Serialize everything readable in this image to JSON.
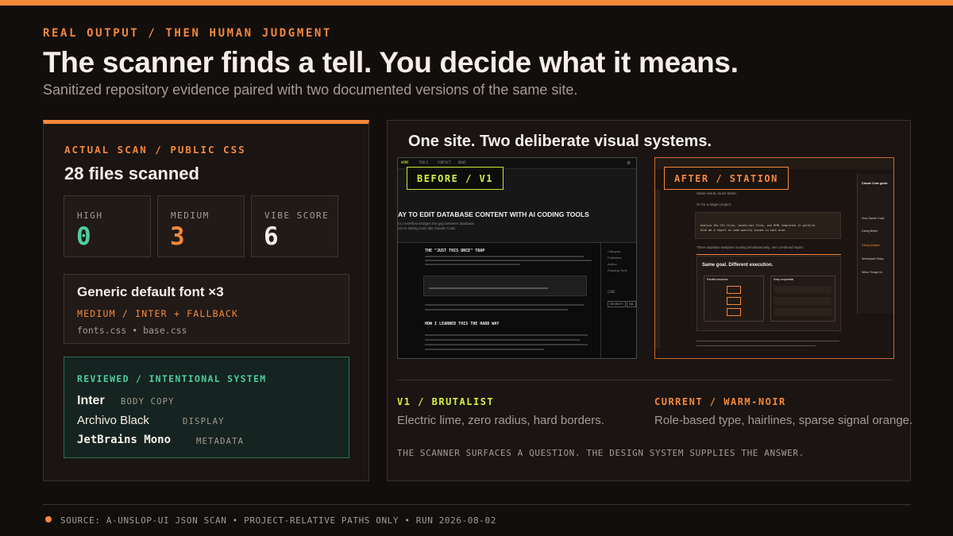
{
  "header": {
    "eyebrow": "REAL OUTPUT / THEN HUMAN JUDGMENT",
    "title": "The scanner finds a tell. You decide what it means.",
    "subtitle": "Sanitized repository evidence paired with two documented versions of the same site."
  },
  "scan": {
    "label": "ACTUAL SCAN / PUBLIC CSS",
    "files_scanned": "28 files scanned",
    "metrics": [
      {
        "label": "HIGH",
        "value": "0",
        "color": "#4fcca3"
      },
      {
        "label": "MEDIUM",
        "value": "3",
        "color": "#f5883a"
      },
      {
        "label": "VIBE SCORE",
        "value": "6",
        "color": "#f5efe8"
      }
    ],
    "tell": {
      "title": "Generic default font ×3",
      "meta": "MEDIUM / INTER + FALLBACK",
      "files": "fonts.css • base.css"
    },
    "reviewed": {
      "label": "REVIEWED / INTENTIONAL SYSTEM",
      "fonts": [
        {
          "name": "Inter",
          "role": "BODY COPY"
        },
        {
          "name": "Archivo Black",
          "role": "DISPLAY"
        },
        {
          "name": "JetBrains Mono",
          "role": "METADATA"
        }
      ]
    }
  },
  "systems": {
    "title": "One site. Two deliberate visual systems.",
    "v1": {
      "tag": "BEFORE / V1",
      "label": "V1 / BRUTALIST",
      "desc": "Electric lime, zero radius, hard borders.",
      "accent": "#d3f03e",
      "shot": {
        "nav": [
          "HOME",
          "TOOLS",
          "CONTACT",
          "NEWS"
        ],
        "headline": "AY TO EDIT DATABASE CONTENT WITH AI CODING TOOLS",
        "sub1": "CLI workflow bridges the gap between database",
        "sub2": "ust AI editing tools like Claude Code.",
        "h1": "THE \"JUST THIS ONCE\" TRAP",
        "h2": "HOW I LEARNED THIS THE HARD WAY",
        "side": [
          "Category",
          "Published",
          "Author",
          "Reading Time"
        ],
        "code_label": "CODE",
        "chips": [
          "SECURITY",
          "SQL"
        ]
      }
    },
    "current": {
      "tag": "AFTER / STATION",
      "label": "CURRENT / WARM-NOIR",
      "desc": "Role-based type, hairlines, sparse signal orange.",
      "accent": "#f5883a",
      "shot": {
        "body1": "Same result, much faster.",
        "body2": "Or for a larger project:",
        "code1": "Analyze the CSS files, JavaScript files, and HTML templates in parallel.",
        "code2": "Give me a report on code quality issues in each area.",
        "body3": "Three separate analyses running simultaneously, one combined report.",
        "card_title": "Same goal. Different execution.",
        "col_a": "Parallel sessions",
        "col_b": "Keep sequential",
        "side_title": "Claude Code guide",
        "side_items": [
          "How Claude Code",
          "Giving Better",
          "Giving Multiple",
          "Workspace Setup",
          "When Things Go"
        ]
      }
    },
    "note": "THE SCANNER SURFACES A QUESTION. THE DESIGN SYSTEM SUPPLIES THE ANSWER."
  },
  "footer": {
    "text": "SOURCE: A-UNSLOP-UI JSON SCAN • PROJECT-RELATIVE PATHS ONLY • RUN 2026-08-02"
  }
}
